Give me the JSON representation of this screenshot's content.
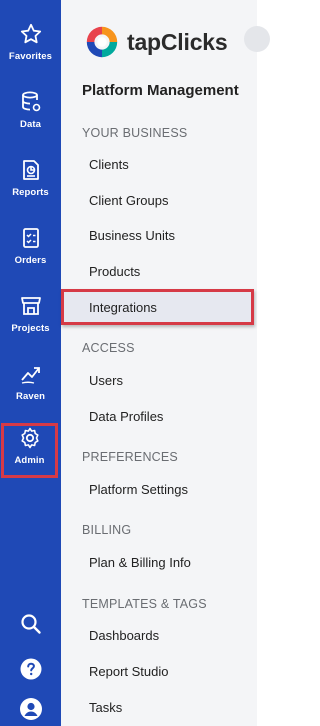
{
  "rail": {
    "items": [
      {
        "label": "Favorites",
        "icon": "star-icon"
      },
      {
        "label": "Data",
        "icon": "database-icon"
      },
      {
        "label": "Reports",
        "icon": "report-icon"
      },
      {
        "label": "Orders",
        "icon": "checklist-icon"
      },
      {
        "label": "Projects",
        "icon": "store-icon"
      },
      {
        "label": "Raven",
        "icon": "trend-icon"
      },
      {
        "label": "Admin",
        "icon": "gear-icon",
        "active": true
      }
    ],
    "bottom": [
      {
        "icon": "search-icon"
      },
      {
        "icon": "help-icon"
      },
      {
        "icon": "user-icon"
      }
    ]
  },
  "brand": {
    "name": "tapClicks"
  },
  "panel": {
    "title": "Platform Management",
    "sections": [
      {
        "heading": "YOUR BUSINESS",
        "items": [
          "Clients",
          "Client Groups",
          "Business Units",
          "Products",
          "Integrations"
        ]
      },
      {
        "heading": "ACCESS",
        "items": [
          "Users",
          "Data Profiles"
        ]
      },
      {
        "heading": "PREFERENCES",
        "items": [
          "Platform Settings"
        ]
      },
      {
        "heading": "BILLING",
        "items": [
          "Plan & Billing Info"
        ]
      },
      {
        "heading": "TEMPLATES & TAGS",
        "items": [
          "Dashboards",
          "Report Studio",
          "Tasks"
        ]
      }
    ],
    "selected_item": "Integrations"
  },
  "colors": {
    "rail": "#1f49b6",
    "highlight": "#d63a46",
    "panel": "#f4f5f7"
  }
}
